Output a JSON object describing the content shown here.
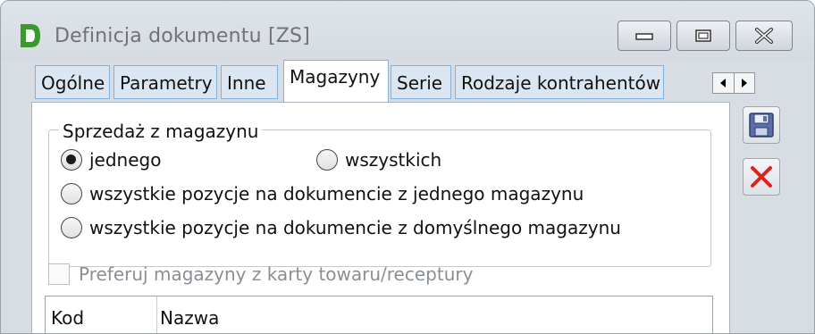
{
  "window": {
    "title": "Definicja dokumentu [ZS]",
    "app_icon_letter": "D",
    "controls": {
      "minimize": "minimize-icon",
      "maximize": "maximize-icon",
      "close": "close-icon"
    }
  },
  "tabs": [
    {
      "label": "Ogólne",
      "active": false
    },
    {
      "label": "Parametry",
      "active": false
    },
    {
      "label": "Inne",
      "active": false
    },
    {
      "label": "Magazyny",
      "active": true
    },
    {
      "label": "Serie",
      "active": false
    },
    {
      "label": "Rodzaje kontrahentów",
      "active": false
    }
  ],
  "sales_group": {
    "label": "Sprzedaż z magazynu",
    "options": [
      {
        "label": "jednego",
        "checked": true
      },
      {
        "label": "wszystkich",
        "checked": false
      },
      {
        "label": "wszystkie pozycje na dokumencie z jednego magazynu",
        "checked": false
      },
      {
        "label": "wszystkie pozycje na dokumencie z domyślnego magazynu",
        "checked": false
      }
    ]
  },
  "prefer_checkbox": {
    "label": "Preferuj magazyny z karty towaru/receptury",
    "checked": false,
    "enabled": false
  },
  "grid": {
    "columns": [
      "Kod",
      "Nazwa"
    ]
  },
  "side_buttons": {
    "save": "save-icon",
    "cancel": "cancel-icon"
  },
  "colors": {
    "accent_tab_border": "#7fb2dd",
    "cancel_red": "#e0211b",
    "app_icon_green": "#3a9a2e"
  }
}
